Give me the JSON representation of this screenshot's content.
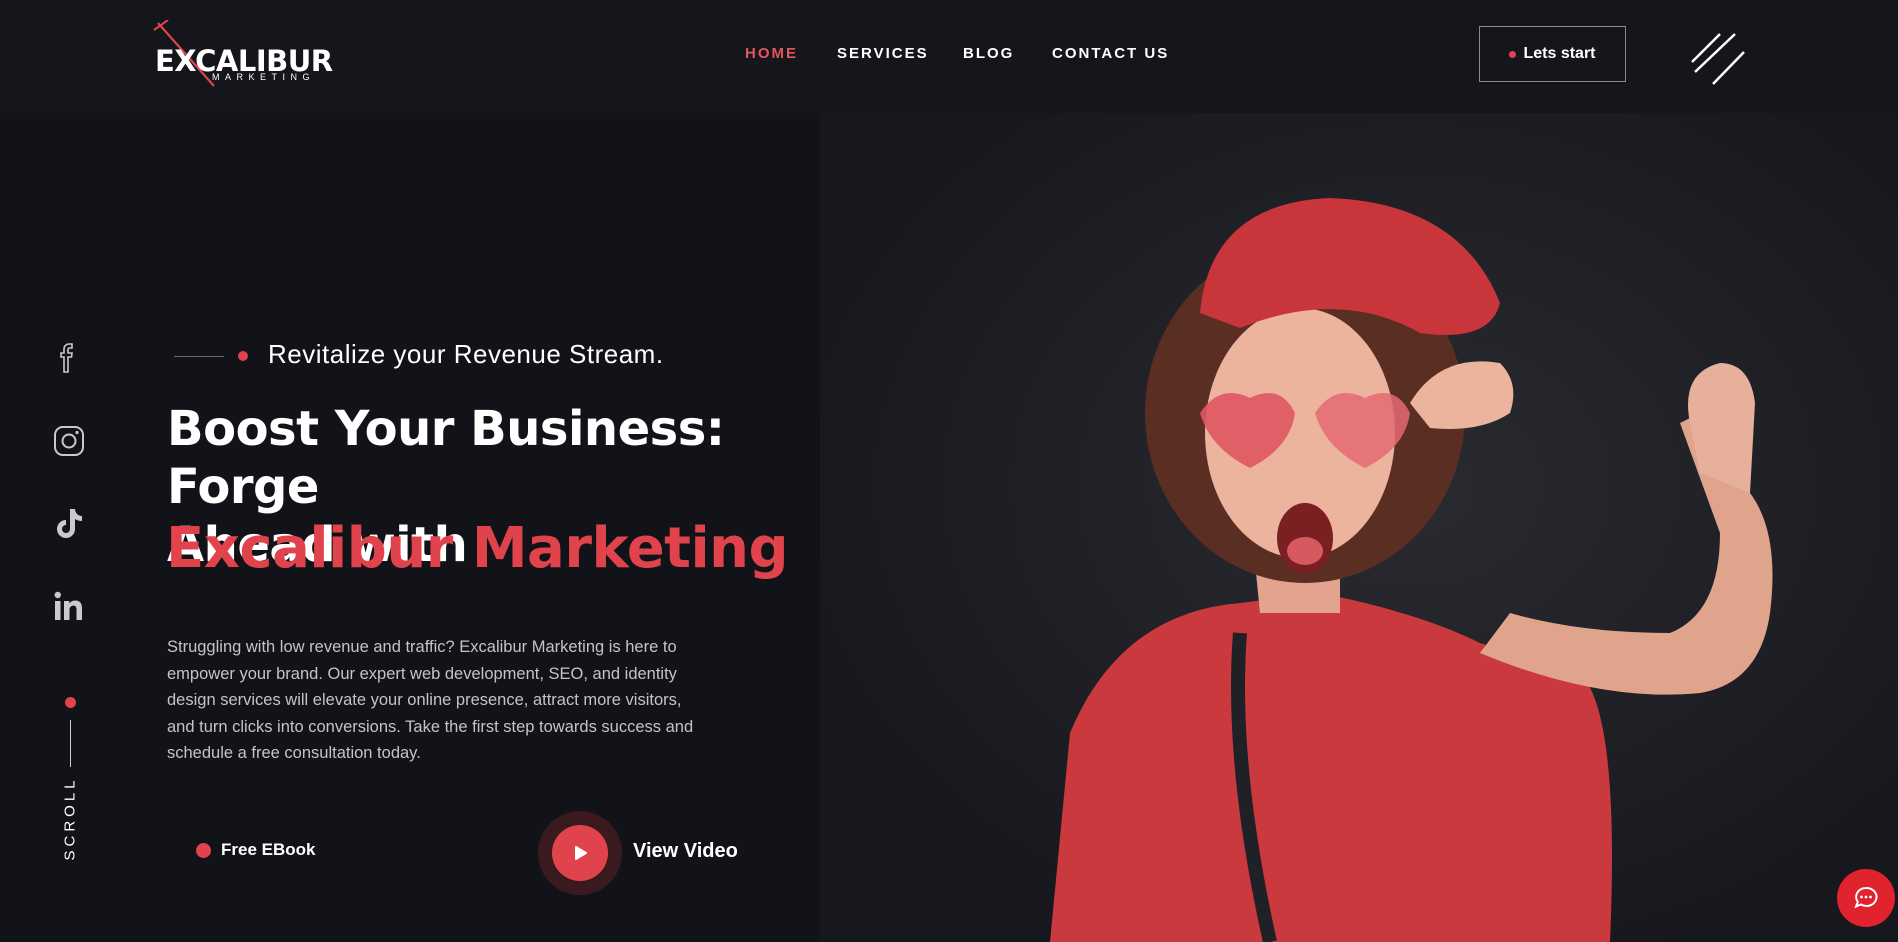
{
  "brand": {
    "logo_main": "EXCALIBUR",
    "logo_sub": "MARKETING"
  },
  "nav": {
    "items": [
      {
        "label": "HOME",
        "active": true
      },
      {
        "label": "SERVICES",
        "active": false
      },
      {
        "label": "BLOG",
        "active": false
      },
      {
        "label": "CONTACT US",
        "active": false
      }
    ]
  },
  "header": {
    "cta_label": "Lets start",
    "menu_icon": "menu-slashes-icon"
  },
  "social": {
    "icons": [
      "facebook-icon",
      "instagram-icon",
      "tiktok-icon",
      "linkedin-icon"
    ],
    "scroll_label": "SCROLL"
  },
  "hero": {
    "tagline": "Revitalize your Revenue Stream.",
    "headline_line1": "Boost Your Business: Forge",
    "headline_line2": "Ahead with",
    "headline_accent": "Excalibur Marketing",
    "description": "Struggling with low revenue and traffic? Excalibur Marketing is here to empower your brand. Our expert web development, SEO, and identity design services will elevate your online presence, attract more visitors, and turn clicks into conversions. Take the first step towards success and schedule a free consultation today.",
    "ebook_label": "Free EBook",
    "video_label": "View Video"
  },
  "chat": {
    "icon": "chat-bubble-icon"
  },
  "colors": {
    "accent": "#e0434c",
    "background": "#121319",
    "chat": "#e0232d"
  }
}
